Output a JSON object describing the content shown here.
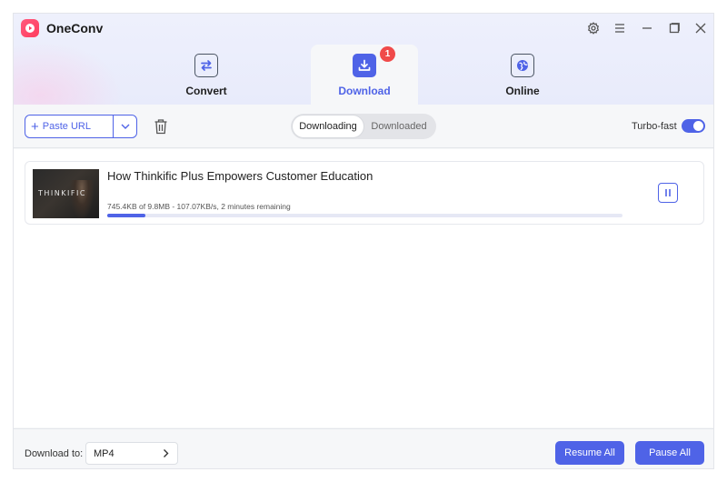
{
  "app": {
    "title": "OneConv"
  },
  "tabs": [
    {
      "label": "Convert",
      "icon": "convert-arrows-icon"
    },
    {
      "label": "Download",
      "icon": "download-icon",
      "badge": "1",
      "active": true
    },
    {
      "label": "Online",
      "icon": "globe-icon"
    }
  ],
  "toolbar": {
    "paste_label": "Paste URL",
    "segments": [
      "Downloading",
      "Downloaded"
    ],
    "active_segment": "Downloading",
    "turbo_label": "Turbo-fast",
    "turbo_on": true
  },
  "downloads": [
    {
      "title": "How Thinkific Plus Empowers Customer Education",
      "thumb_text": "THINKIFIC",
      "status": "745.4KB of 9.8MB -  107.07KB/s, 2 minutes remaining",
      "progress": 0.074
    }
  ],
  "footer": {
    "download_to_label": "Download to:",
    "format": "MP4",
    "resume_all": "Resume All",
    "pause_all": "Pause All"
  },
  "colors": {
    "accent": "#4f63e7",
    "badge": "#f04a4a",
    "logo": "#ff4a6e"
  }
}
